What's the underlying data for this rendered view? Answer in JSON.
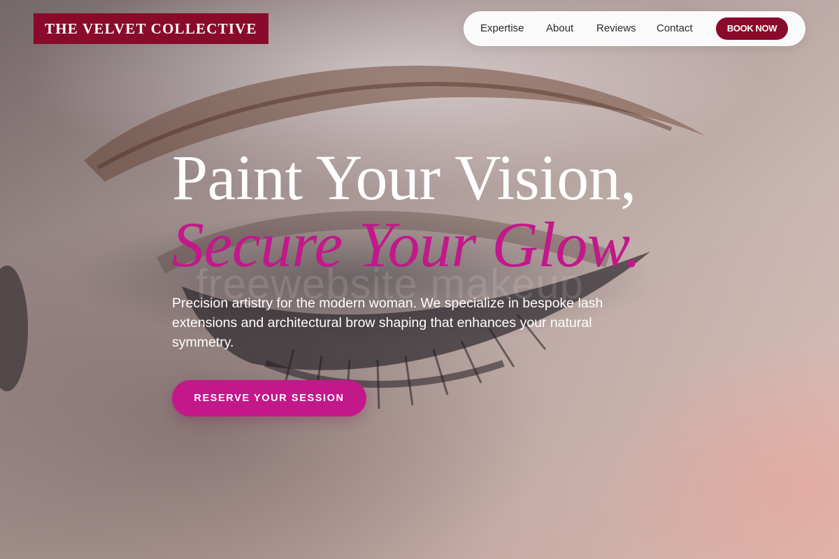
{
  "brand": {
    "name": "THE VELVET COLLECTIVE"
  },
  "nav": {
    "links": [
      "Expertise",
      "About",
      "Reviews",
      "Contact"
    ],
    "book_label": "BOOK NOW"
  },
  "hero": {
    "headline_line1": "Paint Your Vision,",
    "headline_line2": "Secure Your Glow.",
    "watermark": "freewebsite makeup",
    "description": "Precision artistry for the modern woman. We specialize in bespoke lash extensions and architectural brow shaping that enhances your natural symmetry.",
    "cta_label": "RESERVE YOUR SESSION"
  },
  "colors": {
    "brand_burgundy": "#8a0a2c",
    "accent_magenta": "#c2188a",
    "nav_background": "#ffffff",
    "text_light": "#ffffff",
    "text_dark": "#2a2a2e"
  }
}
